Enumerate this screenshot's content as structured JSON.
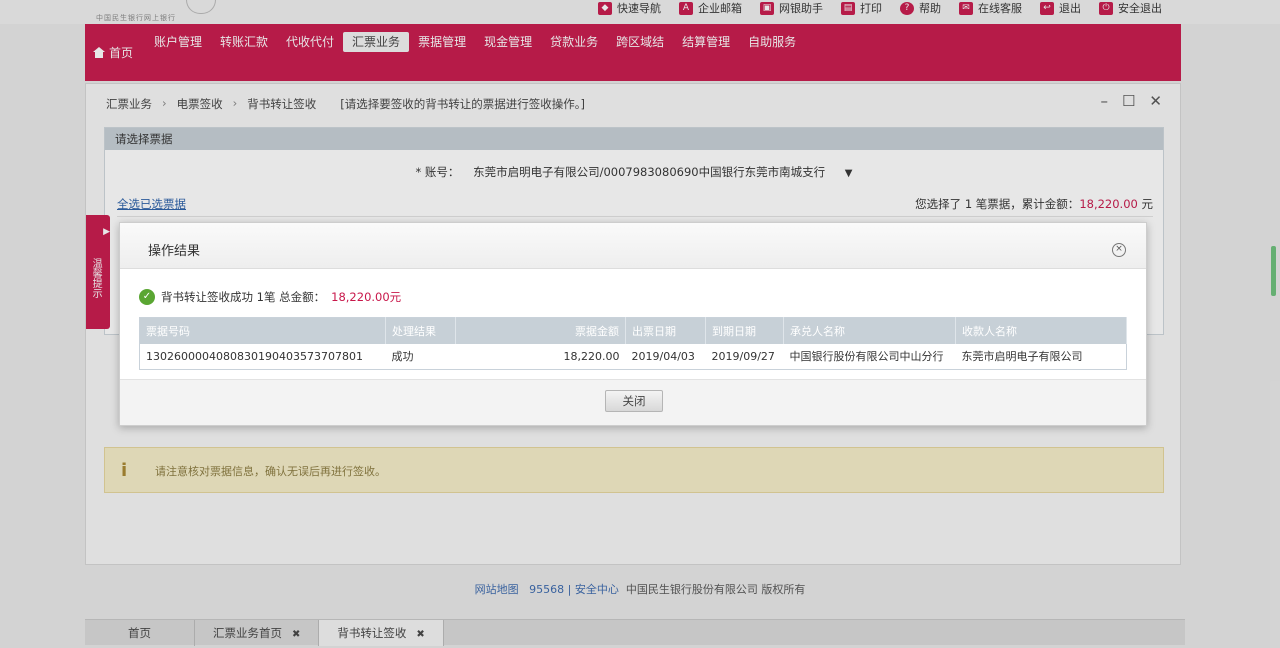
{
  "brand": {
    "tagline": "中国民生银行网上银行"
  },
  "utility_links": [
    {
      "label": "快速导航",
      "icon": "navigation-icon"
    },
    {
      "label": "企业邮箱",
      "icon": "mail-icon"
    },
    {
      "label": "网银助手",
      "icon": "assistant-icon"
    },
    {
      "label": "打印",
      "icon": "printer-icon"
    },
    {
      "label": "帮助",
      "icon": "help-icon"
    },
    {
      "label": "在线客服",
      "icon": "service-icon"
    },
    {
      "label": "退出",
      "icon": "logout-icon"
    },
    {
      "label": "安全退出",
      "icon": "exit-icon"
    }
  ],
  "nav": {
    "home": "首页",
    "items": [
      "账户管理",
      "转账汇款",
      "代收代付",
      "汇票业务",
      "票据管理",
      "现金管理",
      "贷款业务",
      "跨区域结",
      "结算管理",
      "自助服务"
    ],
    "active_index": 3
  },
  "breadcrumb": [
    "汇票业务",
    "电票签收",
    "背书转让签收",
    "[请选择要签收的背书转让的票据进行签收操作。]"
  ],
  "section": {
    "title": "请选择票据",
    "payer_label": "* 账号：",
    "payer_value": "东莞市启明电子有限公司/0007983080690中国银行东莞市南城支行",
    "select_all": "全选已选票据",
    "summary_prefix": "您选择了 1 笔票据，累计金额：",
    "summary_amount": "18,220.00",
    "summary_unit": " 元"
  },
  "side_tab": {
    "label": "温馨提示"
  },
  "notice": {
    "text": "请注意核对票据信息，确认无误后再进行签收。"
  },
  "footer": {
    "link1": "网站地图",
    "link2": "95568 | 安全中心",
    "text": "中国民生银行股份有限公司  版权所有"
  },
  "bottom_tabs": [
    {
      "label": "首页",
      "closable": false
    },
    {
      "label": "汇票业务首页",
      "closable": true
    },
    {
      "label": "背书转让签收",
      "closable": true
    }
  ],
  "modal": {
    "title": "操作结果",
    "result_prefix": "背书转让签收成功 1笔 总金额：",
    "result_amount": "18,220.00元",
    "columns": [
      "票据号码",
      "处理结果",
      "票据金额",
      "出票日期",
      "到期日期",
      "承兑人名称",
      "收款人名称"
    ],
    "rows": [
      [
        "130260000408083019040357370780​1",
        "成功",
        "18,220.00",
        "2019/04/03",
        "2019/09/27",
        "中国银行股份有限公司中山分行",
        "东莞市启明电子有限公司"
      ]
    ],
    "close_button": "关闭"
  }
}
